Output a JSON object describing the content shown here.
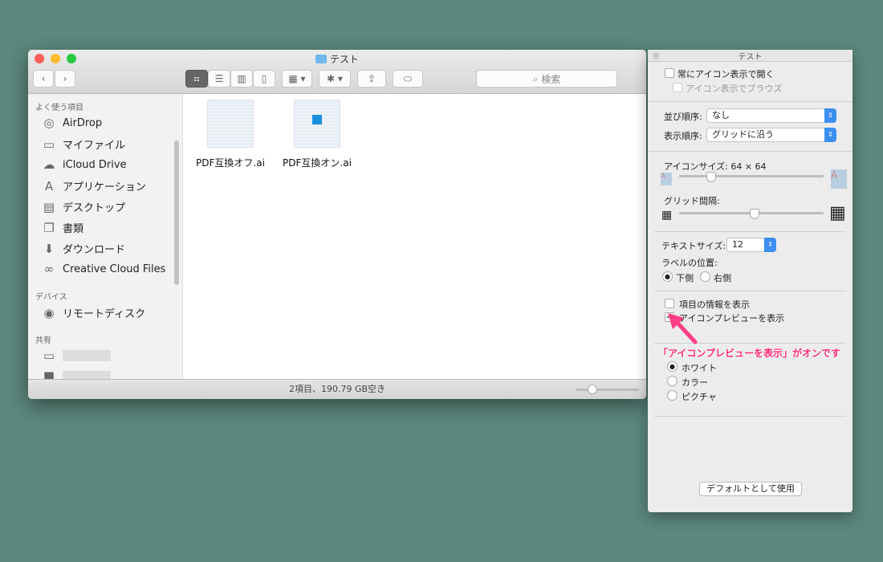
{
  "finder": {
    "title": "テスト",
    "search_placeholder": "検索",
    "sidebar": {
      "favorites_header": "よく使う項目",
      "favorites": [
        {
          "label": "AirDrop",
          "icon": "airdrop-icon"
        },
        {
          "label": "マイファイル",
          "icon": "tray-icon"
        },
        {
          "label": "iCloud Drive",
          "icon": "cloud-icon"
        },
        {
          "label": "アプリケーション",
          "icon": "applications-icon"
        },
        {
          "label": "デスクトップ",
          "icon": "desktop-icon"
        },
        {
          "label": "書類",
          "icon": "documents-icon"
        },
        {
          "label": "ダウンロード",
          "icon": "download-icon"
        },
        {
          "label": "Creative Cloud Files",
          "icon": "creative-cloud-icon"
        }
      ],
      "devices_header": "デバイス",
      "devices": [
        {
          "label": "リモートディスク",
          "icon": "disc-icon"
        }
      ],
      "shared_header": "共有"
    },
    "files": [
      {
        "name": "PDF互換オフ.ai"
      },
      {
        "name": "PDF互換オン.ai"
      }
    ],
    "status": "2項目、190.79 GB空き",
    "icon_size_slider": 0.25
  },
  "panel": {
    "title": "テスト",
    "always_open_icon_view": "常にアイコン表示で開く",
    "browse_icon_view": "アイコン表示でブラウズ",
    "sort_by_label": "並び順序:",
    "sort_by_value": "なし",
    "arrange_label": "表示順序:",
    "arrange_value": "グリッドに沿う",
    "icon_size_label": "アイコンサイズ:",
    "icon_size_value": "64 × 64",
    "icon_size_fraction": 0.22,
    "grid_spacing_label": "グリッド間隔:",
    "grid_spacing_fraction": 0.52,
    "text_size_label": "テキストサイズ:",
    "text_size_value": "12",
    "label_position_label": "ラベルの位置:",
    "label_bottom": "下側",
    "label_right": "右側",
    "show_item_info": "項目の情報を表示",
    "show_icon_preview": "アイコンプレビューを表示",
    "bg_white": "ホワイト",
    "bg_color": "カラー",
    "bg_picture": "ピクチャ",
    "default_button": "デフォルトとして使用"
  },
  "annotation": {
    "text": "「アイコンプレビューを表示」がオンです",
    "color": "#ff2a7a"
  }
}
